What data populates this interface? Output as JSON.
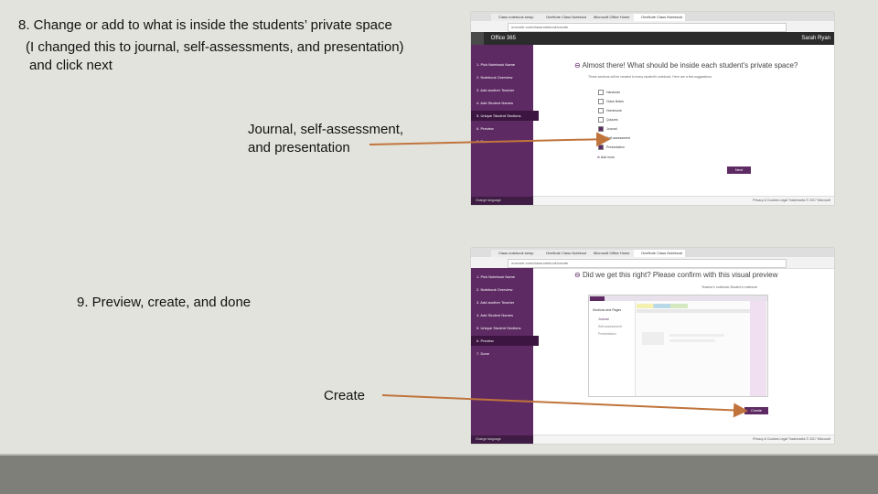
{
  "captions": {
    "step8_line1": "8. Change or add to what is inside the students’ private space",
    "step8_line2": "(I changed this to journal, self-assessments, and presentation)",
    "step8_line3": "and click next",
    "journal_line1": "Journal, self-assessment,",
    "journal_line2": "and presentation",
    "step9": "9. Preview, create, and done",
    "create": "Create"
  },
  "browser": {
    "tabs": [
      "Class notebook setup",
      "OneNote Class Notebook",
      "Microsoft Office Home",
      "OneNote Class Notebook"
    ],
    "url": "onenote.com/classnotebook/create"
  },
  "o365": {
    "app": "Office 365",
    "user": "Sarah Ryan"
  },
  "wizard": {
    "steps": [
      "1. Pick Notebook Name",
      "2. Notebook Overview",
      "3. Add another Teacher",
      "4. Add Student Names",
      "5. Unique Student Sections",
      "6. Preview",
      "7. Done"
    ],
    "sidebar_footer": "Change language",
    "footer_links": "Privacy & Cookies   Legal   Trademarks   © 2017 Microsoft"
  },
  "screen1": {
    "heading": "Almost there! What should be inside each student's private space?",
    "subtext": "These sections will be created in every student's notebook. Here are a few suggestions.",
    "options": [
      {
        "label": "Handouts",
        "checked": false
      },
      {
        "label": "Class Notes",
        "checked": false
      },
      {
        "label": "Homework",
        "checked": false
      },
      {
        "label": "Quizzes",
        "checked": false
      },
      {
        "label": "Journal",
        "checked": true
      },
      {
        "label": "Self-assessment",
        "checked": true
      },
      {
        "label": "Presentation",
        "checked": true
      }
    ],
    "add_more": "Add more",
    "next_button": "Next"
  },
  "screen2": {
    "heading": "Did we get this right? Please confirm with this visual preview",
    "preview_links": "Teacher's notebook   Student's notebook",
    "notebook_title": "Sections and Pages",
    "sections": [
      "Journal",
      "Self-assessment",
      "Presentation"
    ],
    "create_button": "Create"
  },
  "colors": {
    "accent": "#5e2a63",
    "arrow": "#c0743c"
  }
}
